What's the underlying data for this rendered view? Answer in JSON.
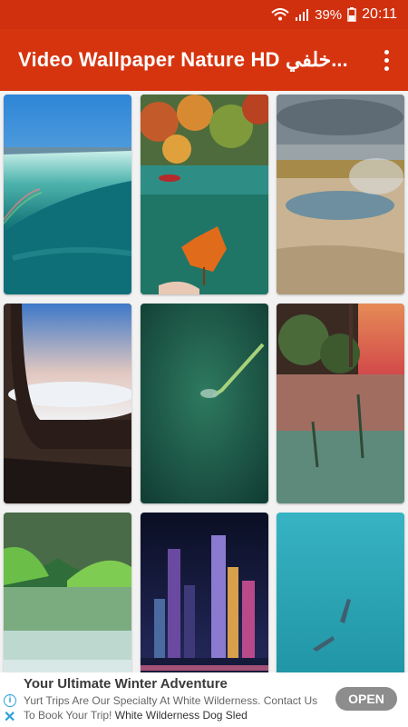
{
  "status_bar": {
    "battery": "39%",
    "time": "20:11"
  },
  "app_bar": {
    "title": "Video Wallpaper Nature HD خلفي...",
    "menu_icon": "more-vertical-icon"
  },
  "colors": {
    "primary": "#d6340f",
    "status": "#d1300f",
    "open_button": "#8d8d8d",
    "ad_icon": "#2aa2d9"
  },
  "wallpapers": [
    "waterfall",
    "autumn-lake",
    "hot-spring",
    "airplane-window",
    "water-drop",
    "sunset-pool",
    "mountain-lake",
    "night-city",
    "underwater-dolphins"
  ],
  "ad": {
    "title": "Your Ultimate Winter Adventure",
    "body": "Yurt Trips Are Our Specialty At White Wilderness. Contact Us To Book Your Trip!",
    "sponsor": "White Wilderness Dog Sled",
    "button": "OPEN"
  }
}
